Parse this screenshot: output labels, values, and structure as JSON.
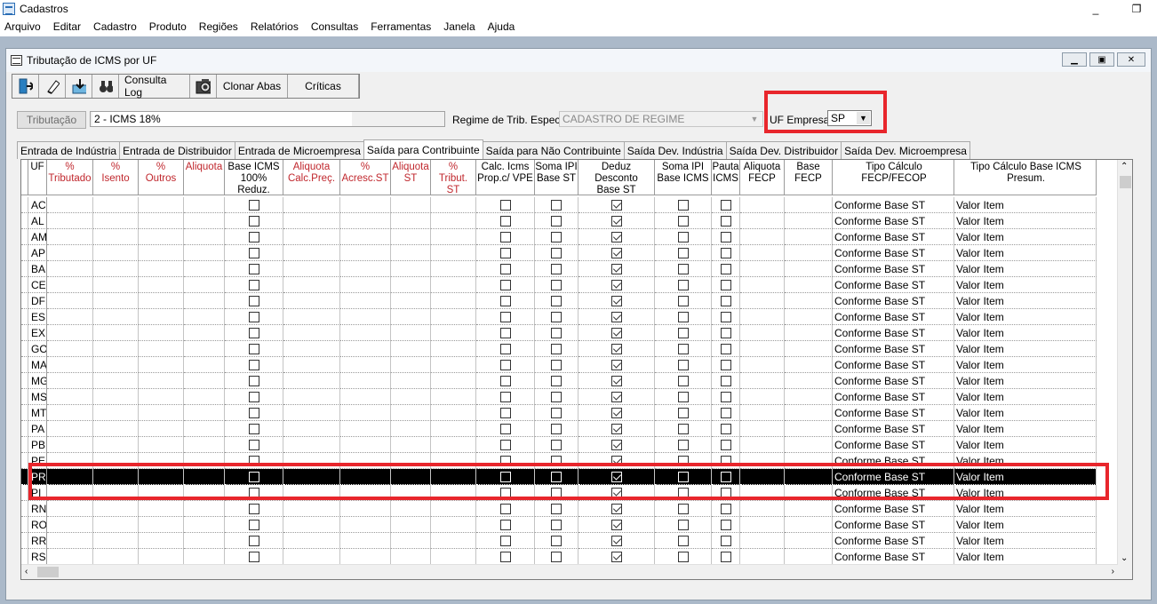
{
  "app": {
    "title": "Cadastros",
    "minimize": "_",
    "restore": "❐"
  },
  "menu": [
    "Arquivo",
    "Editar",
    "Cadastro",
    "Produto",
    "Regiões",
    "Relatórios",
    "Consultas",
    "Ferramentas",
    "Janela",
    "Ajuda"
  ],
  "window": {
    "title": "Tributação de ICMS por UF"
  },
  "toolbar": {
    "consulta_log": "Consulta Log",
    "clonar_abas": "Clonar Abas",
    "criticas": "Críticas",
    "icons": [
      "exit-icon",
      "eraser-icon",
      "save-icon",
      "binoculars-icon",
      "camera-icon"
    ]
  },
  "form": {
    "tributacao_button": "Tributação",
    "tributacao_value": "2 - ICMS 18%",
    "regime_label": "Regime de Trib. Especial",
    "regime_value": "CADASTRO DE REGIME",
    "uf_empresa_label": "UF Empresa",
    "uf_empresa_value": "SP"
  },
  "tabs": [
    "Entrada de Indústria",
    "Entrada de Distribuidor",
    "Entrada de Microempresa",
    "Saída para Contribuinte",
    "Saída para Não Contribuinte",
    "Saída Dev. Indústria",
    "Saída Dev. Distribuidor",
    "Saída Dev. Microempresa"
  ],
  "active_tab": "Saída para Contribuinte",
  "grid": {
    "headers": {
      "uf": "UF",
      "tributado": "%\nTributado",
      "isento": "%\nIsento",
      "outros": "%\nOutros",
      "aliquota": "Aliquota",
      "base_icms": "Base ICMS\n100% Reduz.",
      "aliquota_calc": "Aliquota\nCalc.Preç.",
      "acresc_st": "%\nAcresc.ST",
      "aliquota_st": "Aliquota\nST",
      "tribut_st": "%\nTribut. ST",
      "calc_icms": "Calc. Icms\nProp.c/ VPE",
      "soma_ipi": "Soma IPI\nBase ST",
      "deduz_desconto": "Deduz Desconto\nBase ST",
      "soma_ipi_icms": "Soma IPI\nBase ICMS",
      "pauta": "Pauta\nICMS",
      "aliquota_fecp": "Aliquota\nFECP",
      "base_fecp": "Base\nFECP",
      "tipo_fecp": "Tipo Cálculo FECP/FECOP",
      "tipo_base": "Tipo Cálculo Base ICMS Presum."
    },
    "selected_uf": "PR",
    "rows": [
      {
        "uf": "AC",
        "deduz": true,
        "fecp": "Conforme Base ST",
        "base": "Valor Item"
      },
      {
        "uf": "AL",
        "deduz": true,
        "fecp": "Conforme Base ST",
        "base": "Valor Item"
      },
      {
        "uf": "AM",
        "deduz": true,
        "fecp": "Conforme Base ST",
        "base": "Valor Item"
      },
      {
        "uf": "AP",
        "deduz": true,
        "fecp": "Conforme Base ST",
        "base": "Valor Item"
      },
      {
        "uf": "BA",
        "deduz": true,
        "fecp": "Conforme Base ST",
        "base": "Valor Item"
      },
      {
        "uf": "CE",
        "deduz": true,
        "fecp": "Conforme Base ST",
        "base": "Valor Item"
      },
      {
        "uf": "DF",
        "deduz": true,
        "fecp": "Conforme Base ST",
        "base": "Valor Item"
      },
      {
        "uf": "ES",
        "deduz": true,
        "fecp": "Conforme Base ST",
        "base": "Valor Item"
      },
      {
        "uf": "EX",
        "deduz": true,
        "fecp": "Conforme Base ST",
        "base": "Valor Item"
      },
      {
        "uf": "GO",
        "deduz": true,
        "fecp": "Conforme Base ST",
        "base": "Valor Item"
      },
      {
        "uf": "MA",
        "deduz": true,
        "fecp": "Conforme Base ST",
        "base": "Valor Item"
      },
      {
        "uf": "MG",
        "deduz": true,
        "fecp": "Conforme Base ST",
        "base": "Valor Item"
      },
      {
        "uf": "MS",
        "deduz": true,
        "fecp": "Conforme Base ST",
        "base": "Valor Item"
      },
      {
        "uf": "MT",
        "deduz": true,
        "fecp": "Conforme Base ST",
        "base": "Valor Item"
      },
      {
        "uf": "PA",
        "deduz": true,
        "fecp": "Conforme Base ST",
        "base": "Valor Item"
      },
      {
        "uf": "PB",
        "deduz": true,
        "fecp": "Conforme Base ST",
        "base": "Valor Item"
      },
      {
        "uf": "PE",
        "deduz": true,
        "fecp": "Conforme Base ST",
        "base": "Valor Item"
      },
      {
        "uf": "PR",
        "deduz": true,
        "fecp": "Conforme Base ST",
        "base": "Valor Item"
      },
      {
        "uf": "PI",
        "deduz": true,
        "fecp": "Conforme Base ST",
        "base": "Valor Item"
      },
      {
        "uf": "RN",
        "deduz": true,
        "fecp": "Conforme Base ST",
        "base": "Valor Item"
      },
      {
        "uf": "RO",
        "deduz": true,
        "fecp": "Conforme Base ST",
        "base": "Valor Item"
      },
      {
        "uf": "RR",
        "deduz": true,
        "fecp": "Conforme Base ST",
        "base": "Valor Item"
      },
      {
        "uf": "RS",
        "deduz": true,
        "fecp": "Conforme Base ST",
        "base": "Valor Item"
      }
    ]
  },
  "highlight_color": "#e8262c"
}
